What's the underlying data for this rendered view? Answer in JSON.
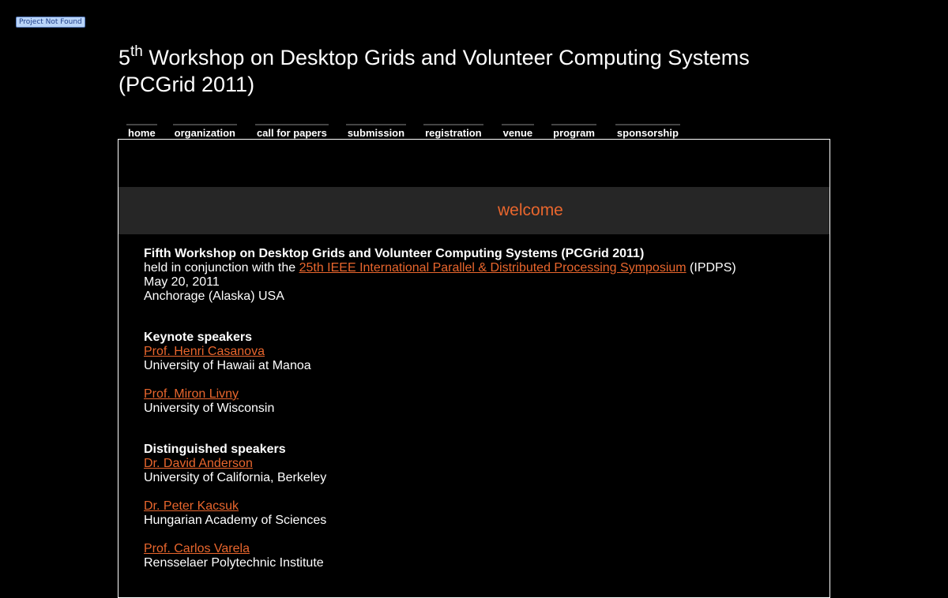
{
  "badge": "Project Not Found",
  "title": {
    "ordinal": "5",
    "ordinal_suffix": "th",
    "line1_rest": " Workshop on Desktop Grids and Volunteer Computing Systems",
    "line2": "(PCGrid 2011)"
  },
  "nav": [
    "home",
    "organization",
    "call for papers",
    "submission",
    "registration",
    "venue",
    "program",
    "sponsorship"
  ],
  "welcome": "welcome",
  "intro": {
    "heading": "Fifth Workshop on Desktop Grids and Volunteer Computing Systems (PCGrid 2011)",
    "held_prefix": "held in conjunction with the ",
    "ipdps_link": "25th IEEE International Parallel & Distributed Processing Symposium",
    "held_suffix": " (IPDPS)",
    "date": "May 20, 2011",
    "location": "Anchorage (Alaska) USA"
  },
  "keynote": {
    "heading": "Keynote speakers",
    "speakers": [
      {
        "name": "Prof. Henri Casanova",
        "affiliation": "University of Hawaii at Manoa"
      },
      {
        "name": "Prof. Miron Livny",
        "affiliation": "University of Wisconsin"
      }
    ]
  },
  "distinguished": {
    "heading": "Distinguished speakers",
    "speakers": [
      {
        "name": "Dr. David Anderson",
        "affiliation": "University of California, Berkeley"
      },
      {
        "name": "Dr. Peter Kacsuk",
        "affiliation": "Hungarian Academy of Sciences"
      },
      {
        "name": "Prof. Carlos Varela",
        "affiliation": "Rensselaer Polytechnic Institute"
      }
    ]
  },
  "colors": {
    "background": "#000000",
    "accent": "#e9662d",
    "welcome_bar": "#262626",
    "text": "#ffffff"
  }
}
